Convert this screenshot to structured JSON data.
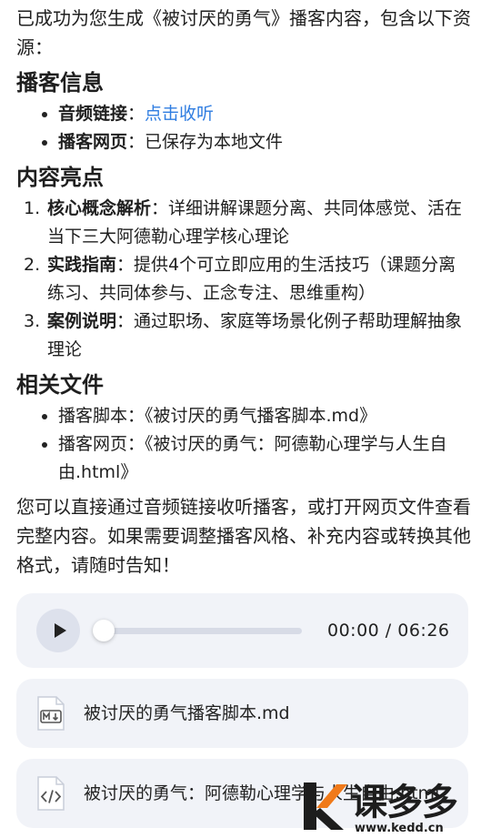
{
  "intro": "已成功为您生成《被讨厌的勇气》播客内容，包含以下资源：",
  "sections": {
    "info": {
      "heading": "播客信息",
      "items": [
        {
          "label": "音频链接",
          "sep": "：",
          "value": "点击收听"
        },
        {
          "label": "播客网页",
          "sep": "：",
          "value": "已保存为本地文件"
        }
      ]
    },
    "highlights": {
      "heading": "内容亮点",
      "items": [
        {
          "num": "1.",
          "label": "核心概念解析",
          "text": "：详细讲解课题分离、共同体感觉、活在当下三大阿德勒心理学核心理论"
        },
        {
          "num": "2.",
          "label": "实践指南",
          "text": "：提供4个可立即应用的生活技巧（课题分离练习、共同体参与、正念专注、思维重构）"
        },
        {
          "num": "3.",
          "label": "案例说明",
          "text": "：通过职场、家庭等场景化例子帮助理解抽象理论"
        }
      ]
    },
    "files": {
      "heading": "相关文件",
      "items": [
        "播客脚本：《被讨厌的勇气播客脚本.md》",
        "播客网页：《被讨厌的勇气：阿德勒心理学与人生自由.html》"
      ]
    }
  },
  "outro": "您可以直接通过音频链接收听播客，或打开网页文件查看完整内容。如果需要调整播客风格、补充内容或转换其他格式，请随时告知！",
  "player": {
    "time": "00:00 / 06:26",
    "progress": 0.0
  },
  "file_cards": [
    {
      "name": "被讨厌的勇气播客脚本.md",
      "icon": "markdown-file-icon"
    },
    {
      "name": "被讨厌的勇气：阿德勒心理学与人生自由.html",
      "icon": "code-file-icon"
    }
  ],
  "watermark": {
    "title": "课多多",
    "url": "www.kedd.cn"
  },
  "colors": {
    "link": "#2f7de1",
    "card_bg": "#f1f3f8",
    "watermark_orange": "#f07a1a"
  }
}
